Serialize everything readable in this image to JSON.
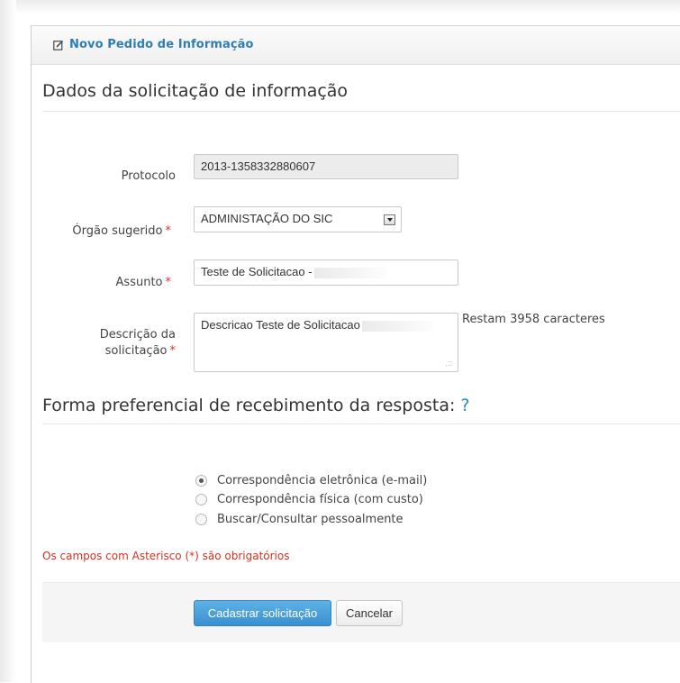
{
  "header": {
    "title": "Novo Pedido de Informação",
    "icon": "edit-icon"
  },
  "section1": {
    "title": "Dados da solicitação de informação"
  },
  "protocolo": {
    "label": "Protocolo",
    "value": "2013-1358332880607"
  },
  "orgao": {
    "label": "Órgão sugerido",
    "required_mark": "*",
    "selected": "ADMINISTAÇÃO DO SIC"
  },
  "assunto": {
    "label": "Assunto",
    "required_mark": "*",
    "value": "Teste de Solicitacao -"
  },
  "descricao": {
    "label_line1": "Descrição da",
    "label_line2": "solicitação",
    "required_mark": "*",
    "value": "Descricao Teste de Solicitacao",
    "counter": "Restam 3958 caracteres"
  },
  "section2": {
    "title": "Forma preferencial de recebimento da resposta:",
    "help": "?"
  },
  "options": [
    {
      "label": "Correspondência eletrônica (e-mail)",
      "checked": true
    },
    {
      "label": "Correspondência física (com custo)",
      "checked": false
    },
    {
      "label": "Buscar/Consultar pessoalmente",
      "checked": false
    }
  ],
  "required_note": "Os campos com Asterisco (*) são obrigatórios",
  "actions": {
    "submit_label": "Cadastrar solicitação",
    "cancel_label": "Cancelar"
  },
  "colors": {
    "accent": "#2f7db5",
    "primary_button": "#3a8fd0",
    "required": "#e03131"
  }
}
